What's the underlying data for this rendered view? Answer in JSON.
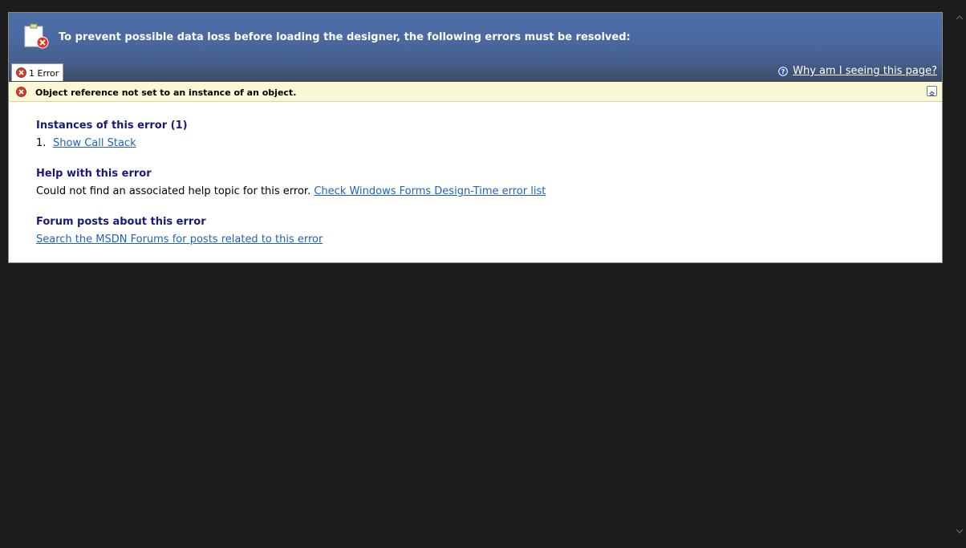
{
  "banner": {
    "title": "To prevent possible data loss before loading the designer, the following errors must be resolved:",
    "icon": "document-error-icon"
  },
  "tab": {
    "label": "1 Error",
    "icon": "error-icon"
  },
  "help_link": {
    "label": "Why am I seeing this page?",
    "icon": "help-icon"
  },
  "error": {
    "message": "Object reference not set to an instance of an object.",
    "icon": "error-icon",
    "collapse_icon": "collapse-up-icon"
  },
  "sections": {
    "instances": {
      "heading": "Instances of this error (1)",
      "items": [
        {
          "number": "1.",
          "label": "Show Call Stack"
        }
      ]
    },
    "help": {
      "heading": "Help with this error",
      "text": "Could not find an associated help topic for this error.",
      "link": "Check Windows Forms Design-Time error list"
    },
    "forum": {
      "heading": "Forum posts about this error",
      "link": "Search the MSDN Forums for posts related to this error"
    }
  },
  "colors": {
    "banner": "#4a69a0",
    "error_bar": "#fbf8d6",
    "heading": "#1a1a78",
    "link": "#1e63b8",
    "background": "#1c1c1c"
  }
}
